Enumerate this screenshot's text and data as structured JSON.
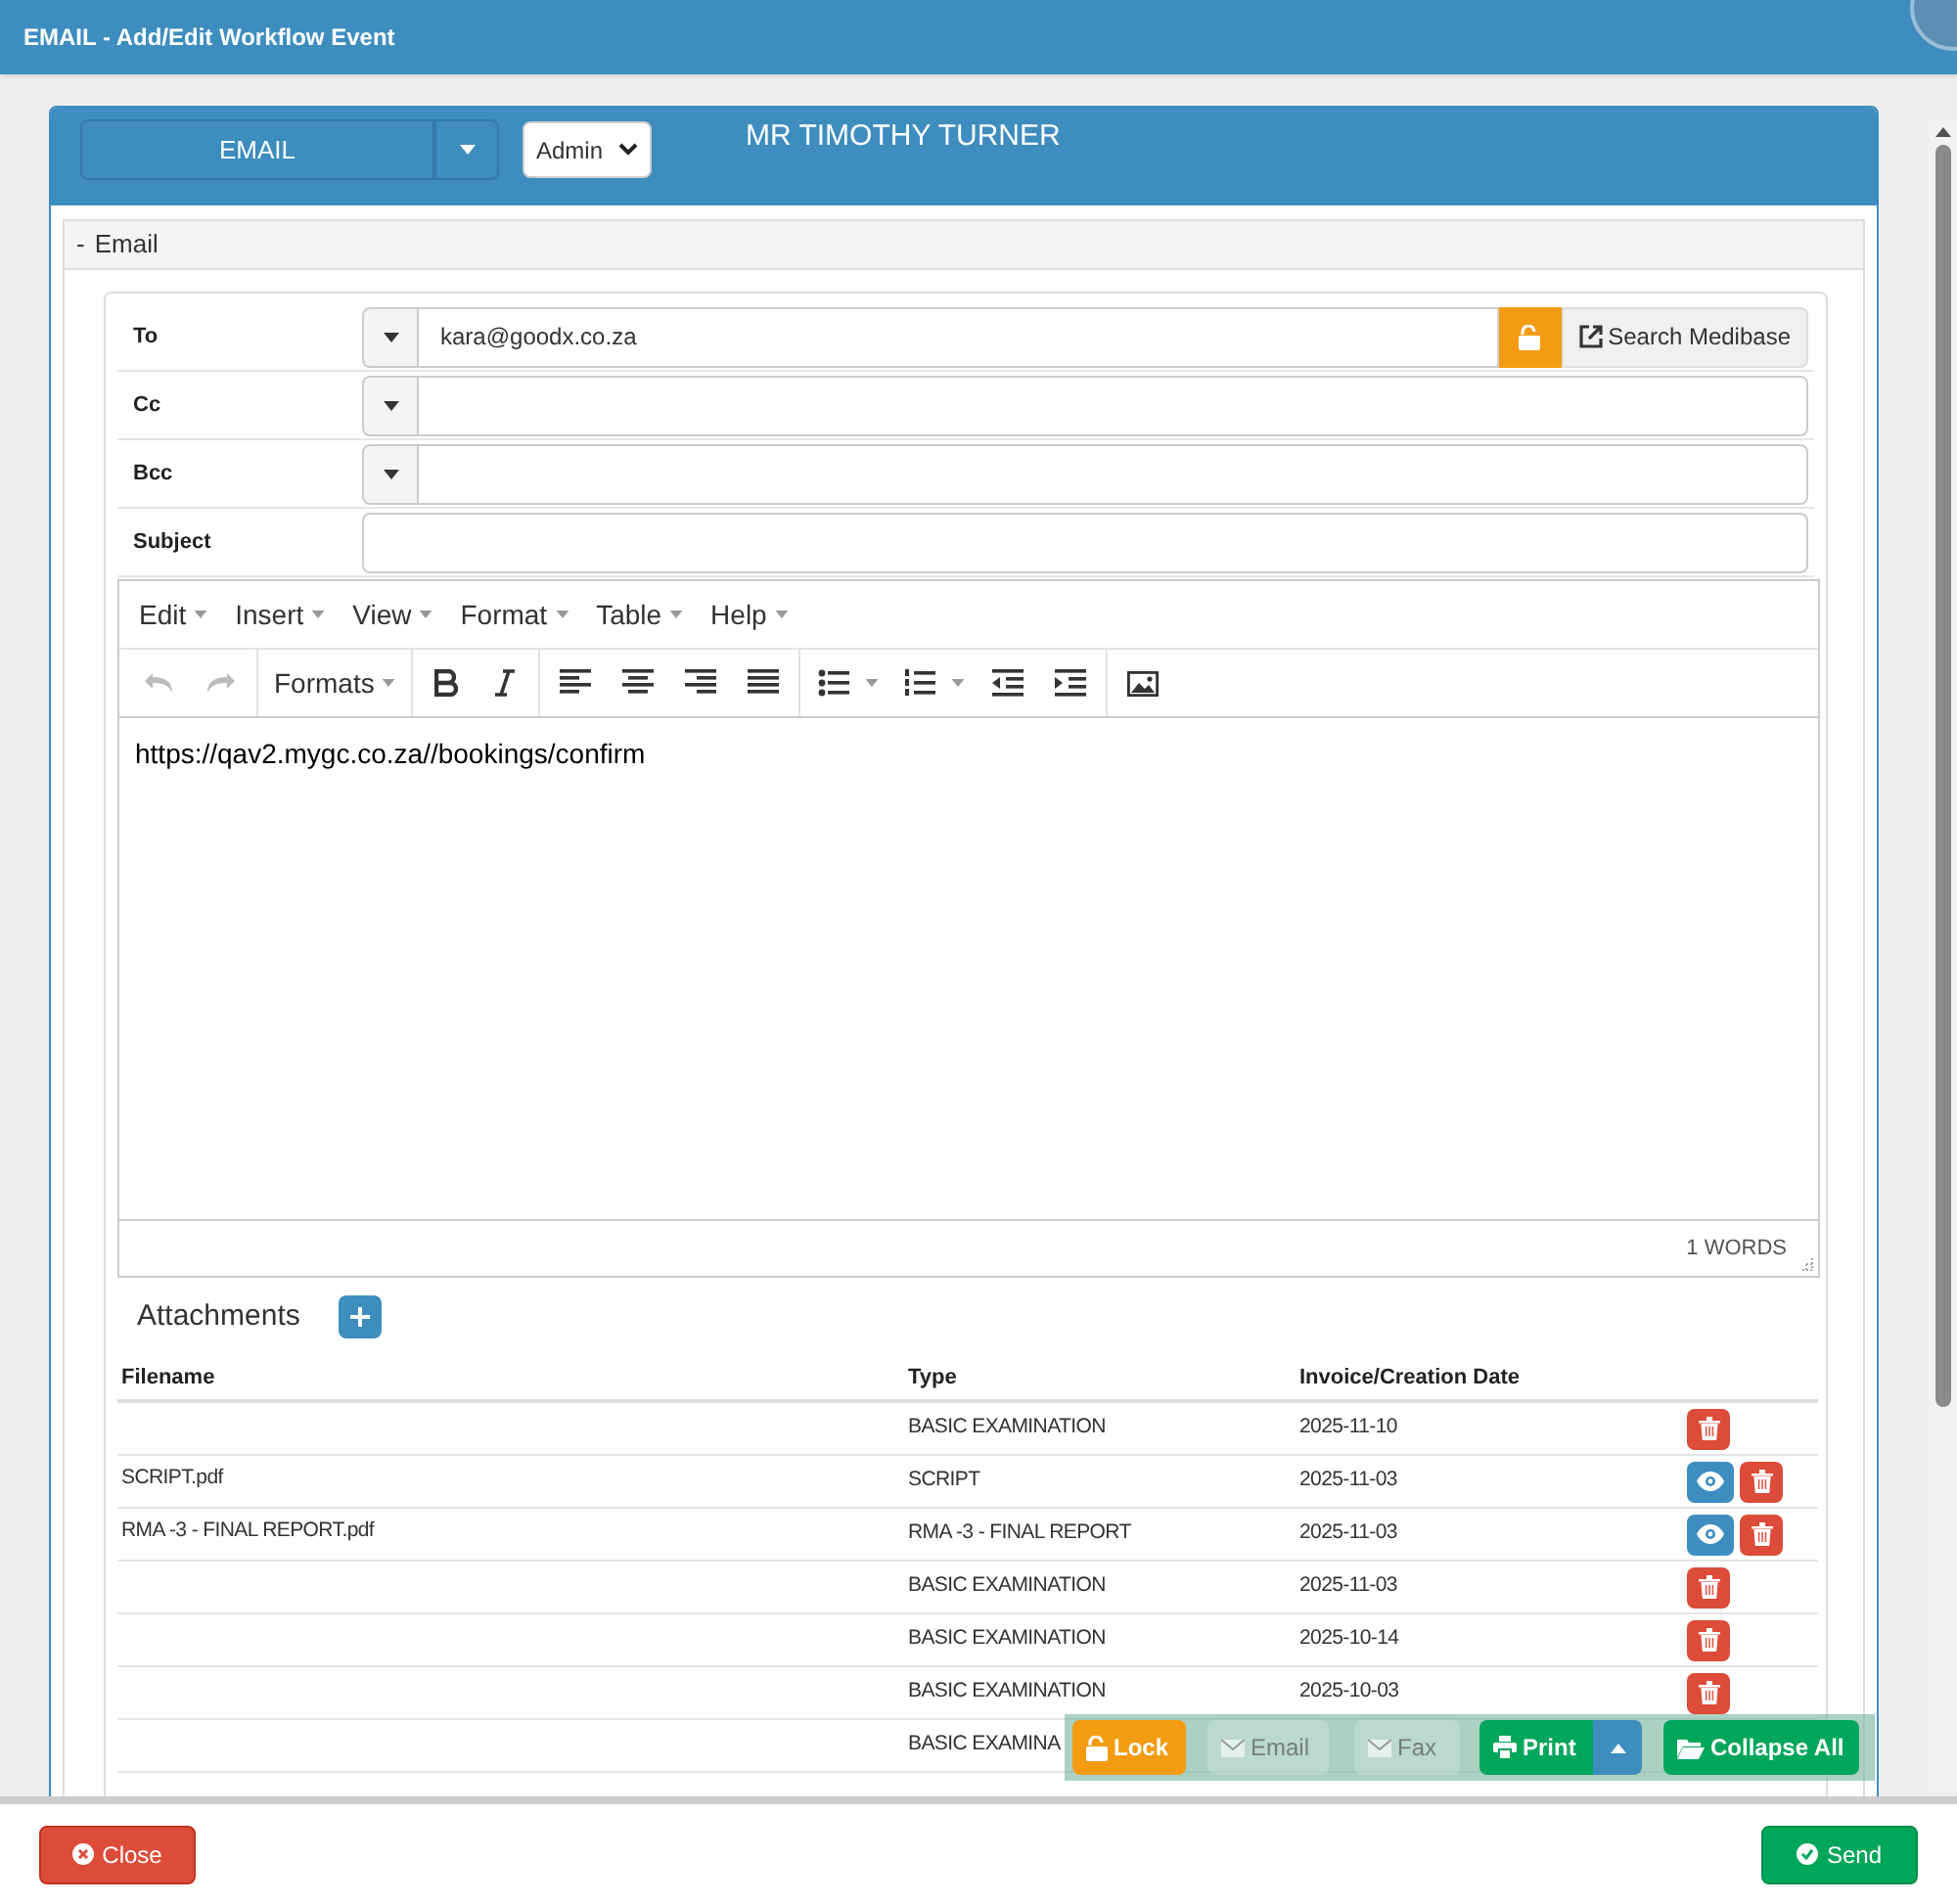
{
  "window": {
    "title": "EMAIL - Add/Edit Workflow Event"
  },
  "panel": {
    "event_type": "EMAIL",
    "user_select": "Admin",
    "patient": "MR TIMOTHY TURNER"
  },
  "section": {
    "toggle": "-",
    "title": "Email",
    "expanded": true
  },
  "fields": [
    {
      "kind": "address",
      "label": "To",
      "value": "kara@goodx.co.za",
      "lock": true,
      "search": "Search Medibase"
    },
    {
      "kind": "address",
      "label": "Cc"
    },
    {
      "kind": "address",
      "label": "Bcc"
    },
    {
      "kind": "subject",
      "label": "Subject"
    }
  ],
  "editor": {
    "menus": [
      "Edit",
      "Insert",
      "View",
      "Format",
      "Table",
      "Help"
    ],
    "formats": "Formats",
    "undo_disabled": true,
    "redo_disabled": true,
    "body": "https://qav2.mygc.co.za//bookings/confirm",
    "word_count": "1 WORDS"
  },
  "attachments": {
    "title": "Attachments",
    "columns": [
      "Filename",
      "Type",
      "Invoice/Creation Date"
    ],
    "rows": [
      {
        "type": "BASIC EXAMINATION",
        "date": "2025-11-10",
        "view": false,
        "delete": true
      },
      {
        "filename": "SCRIPT.pdf",
        "type": "SCRIPT",
        "date": "2025-11-03",
        "view": true,
        "delete": true
      },
      {
        "filename": "RMA -3 - FINAL REPORT.pdf",
        "type": "RMA -3 - FINAL REPORT",
        "date": "2025-11-03",
        "view": true,
        "delete": true
      },
      {
        "type": "BASIC EXAMINATION",
        "date": "2025-11-03",
        "view": false,
        "delete": true
      },
      {
        "type": "BASIC EXAMINATION",
        "date": "2025-10-14",
        "view": false,
        "delete": true
      },
      {
        "type": "BASIC EXAMINATION",
        "date": "2025-10-03",
        "view": false,
        "delete": true
      },
      {
        "type": "BASIC EXAMINA"
      }
    ]
  },
  "float_toolbar": [
    {
      "kind": "lock",
      "label": "Lock",
      "disabled": false
    },
    {
      "kind": "email",
      "label": "Email",
      "disabled": true
    },
    {
      "kind": "fax",
      "label": "Fax",
      "disabled": true
    },
    {
      "kind": "print",
      "label": "Print",
      "disabled": false
    },
    {
      "kind": "collapse",
      "label": "Collapse All",
      "disabled": false
    }
  ],
  "footer": {
    "close": "Close",
    "send": "Send"
  }
}
